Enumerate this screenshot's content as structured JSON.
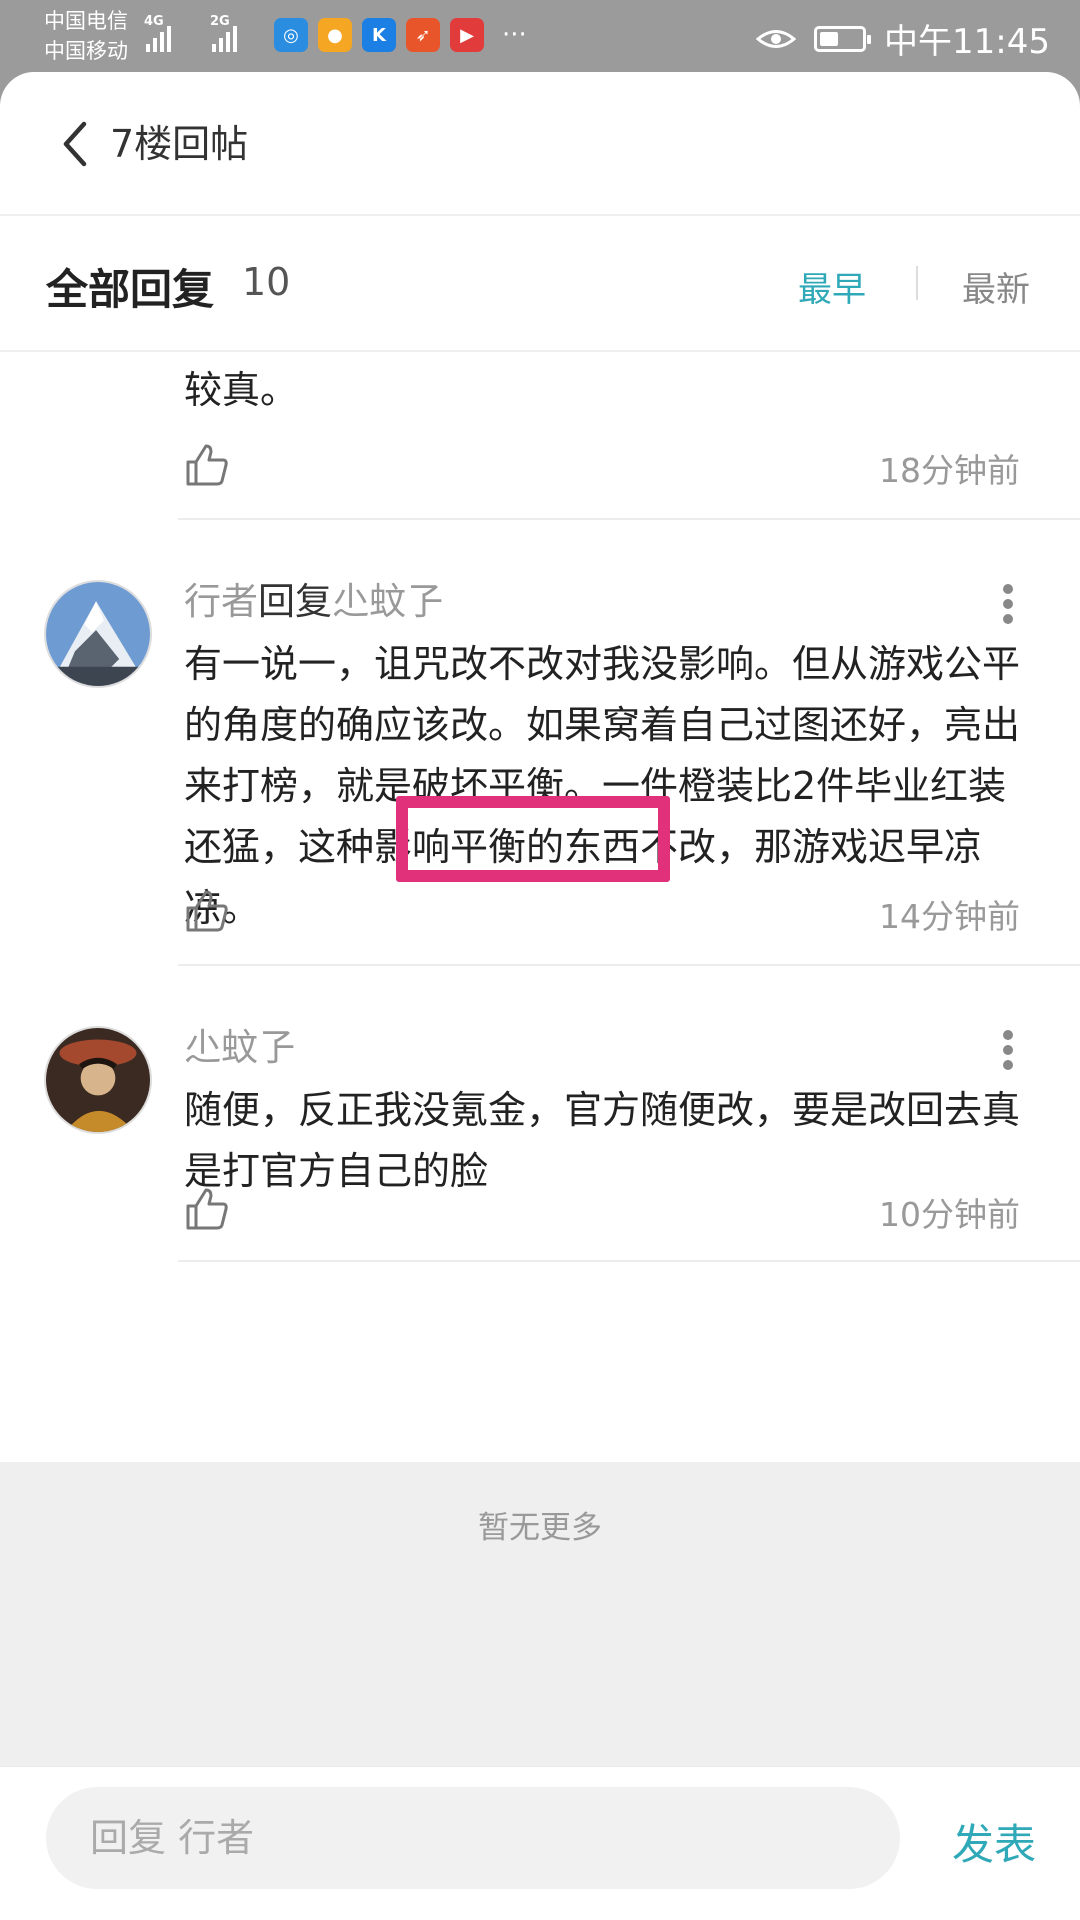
{
  "status_bar": {
    "carrier1": "中国电信",
    "carrier2": "中国移动",
    "net1": "4G",
    "net2": "2G",
    "app_icons": [
      "browser-icon",
      "wallet-icon",
      "kugou-icon",
      "game-icon",
      "video-icon"
    ],
    "more": "···",
    "time": "中午11:45",
    "battery_level": 0.45
  },
  "header": {
    "title": "7楼回帖"
  },
  "replies_header": {
    "title": "全部回复",
    "count": "10",
    "sort_earliest": "最早",
    "sort_latest": "最新",
    "active_sort": "最早"
  },
  "comments": [
    {
      "text_partial": "较真。",
      "time": "18分钟前"
    },
    {
      "author": "行者",
      "reply_word": "回复",
      "reply_to": "尐蚊孒",
      "text": "有一说一，诅咒改不改对我没影响。但从游戏公平的角度",
      "text_highlight": "的确应该改",
      "text_after": "。如果窝着自己过图还好，亮出来打榜，就是破坏平衡。一件橙装比2件毕业红装还猛，这种影响平衡的东西不改，那游戏迟早凉凉。",
      "time": "14分钟前"
    },
    {
      "author": "尐蚊孒",
      "text": "随便，反正我没氪金，官方随便改，要是改回去真是打官方自己的脸",
      "time": "10分钟前"
    }
  ],
  "no_more": "暂无更多",
  "composer": {
    "placeholder": "回复 行者",
    "send_label": "发表"
  },
  "colors": {
    "accent": "#2fa9b8",
    "highlight_border": "#e0317a"
  }
}
